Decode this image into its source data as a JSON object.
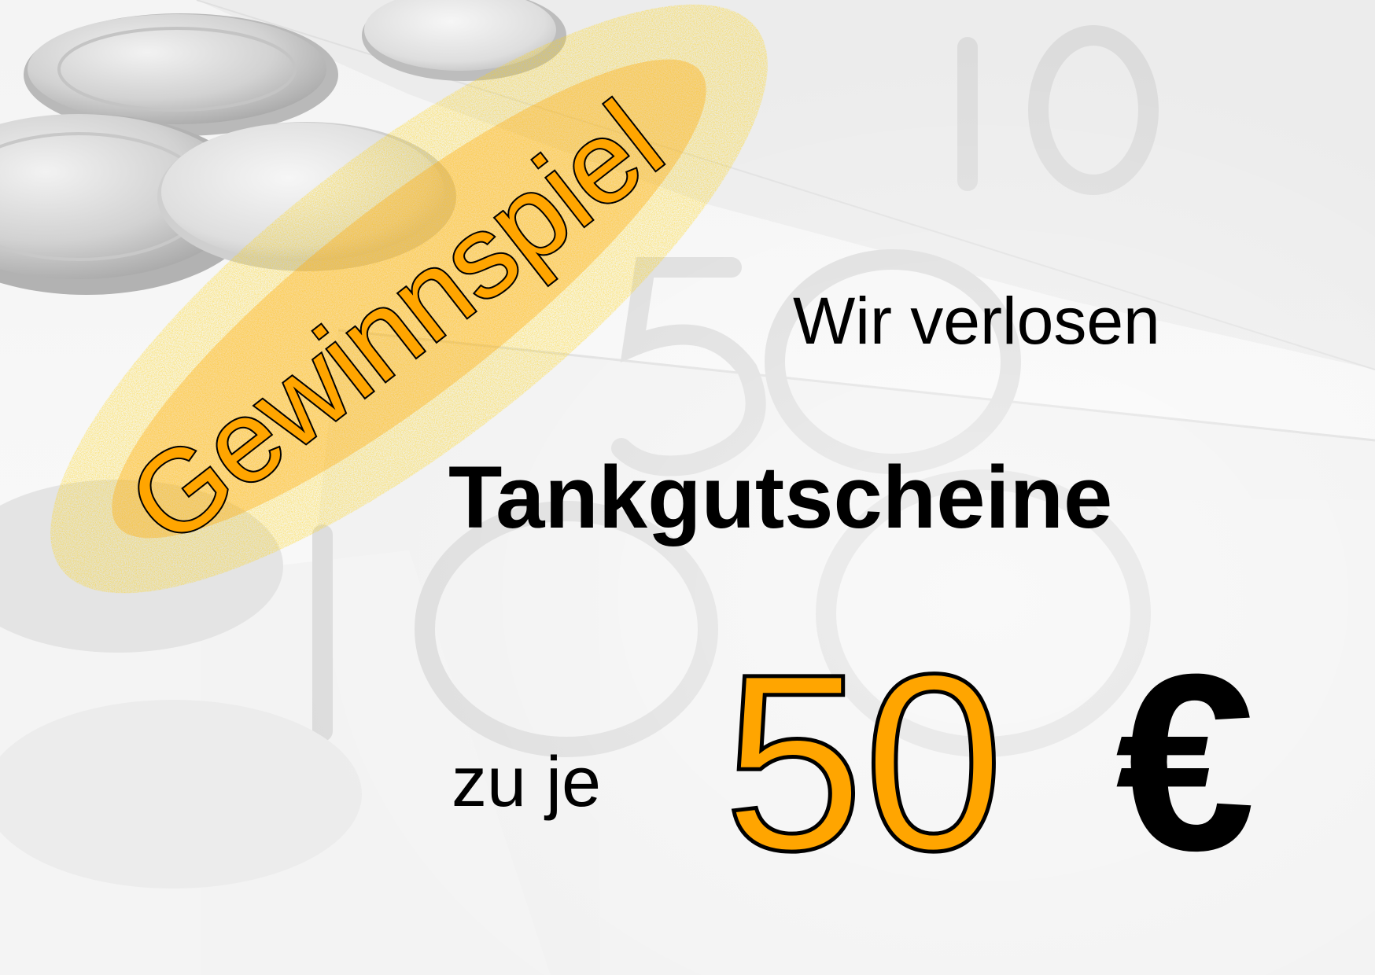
{
  "headline": "Gewinnspiel",
  "intro_text": "Wir verlosen",
  "prize_title": "Tankgutscheine",
  "amount_prefix": "zu je",
  "amount_value": "50",
  "currency_symbol": "€",
  "colors": {
    "accent": "#FFA500",
    "text": "#000000",
    "background": "#F5F5F5"
  },
  "background_picture": "grayscale euro banknotes and coins"
}
